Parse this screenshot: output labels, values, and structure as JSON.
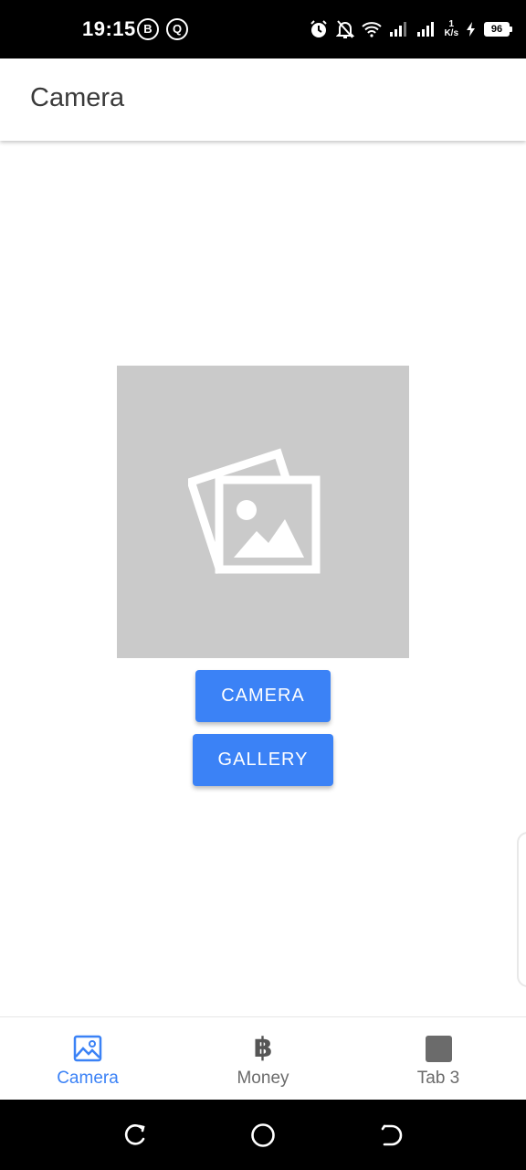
{
  "status_bar": {
    "time": "19:15",
    "badge_b": "B",
    "badge_q": "Q",
    "net_speed_value": "1",
    "net_speed_unit": "K/s",
    "battery": "96",
    "icons": [
      "alarm-icon",
      "bell-off-icon",
      "wifi-icon",
      "signal-icon",
      "signal-icon",
      "charging-icon"
    ]
  },
  "app_bar": {
    "title": "Camera"
  },
  "main": {
    "placeholder_icon": "photos-icon",
    "camera_button": "CAMERA",
    "gallery_button": "GALLERY"
  },
  "tabs": [
    {
      "label": "Camera",
      "icon": "image-icon",
      "active": true
    },
    {
      "label": "Money",
      "icon": "bitcoin-icon",
      "active": false
    },
    {
      "label": "Tab 3",
      "icon": "square-icon",
      "active": false
    }
  ],
  "colors": {
    "accent": "#3b82f6",
    "placeholder_bg": "#cacaca",
    "inactive_tab": "#6b6b6b"
  }
}
